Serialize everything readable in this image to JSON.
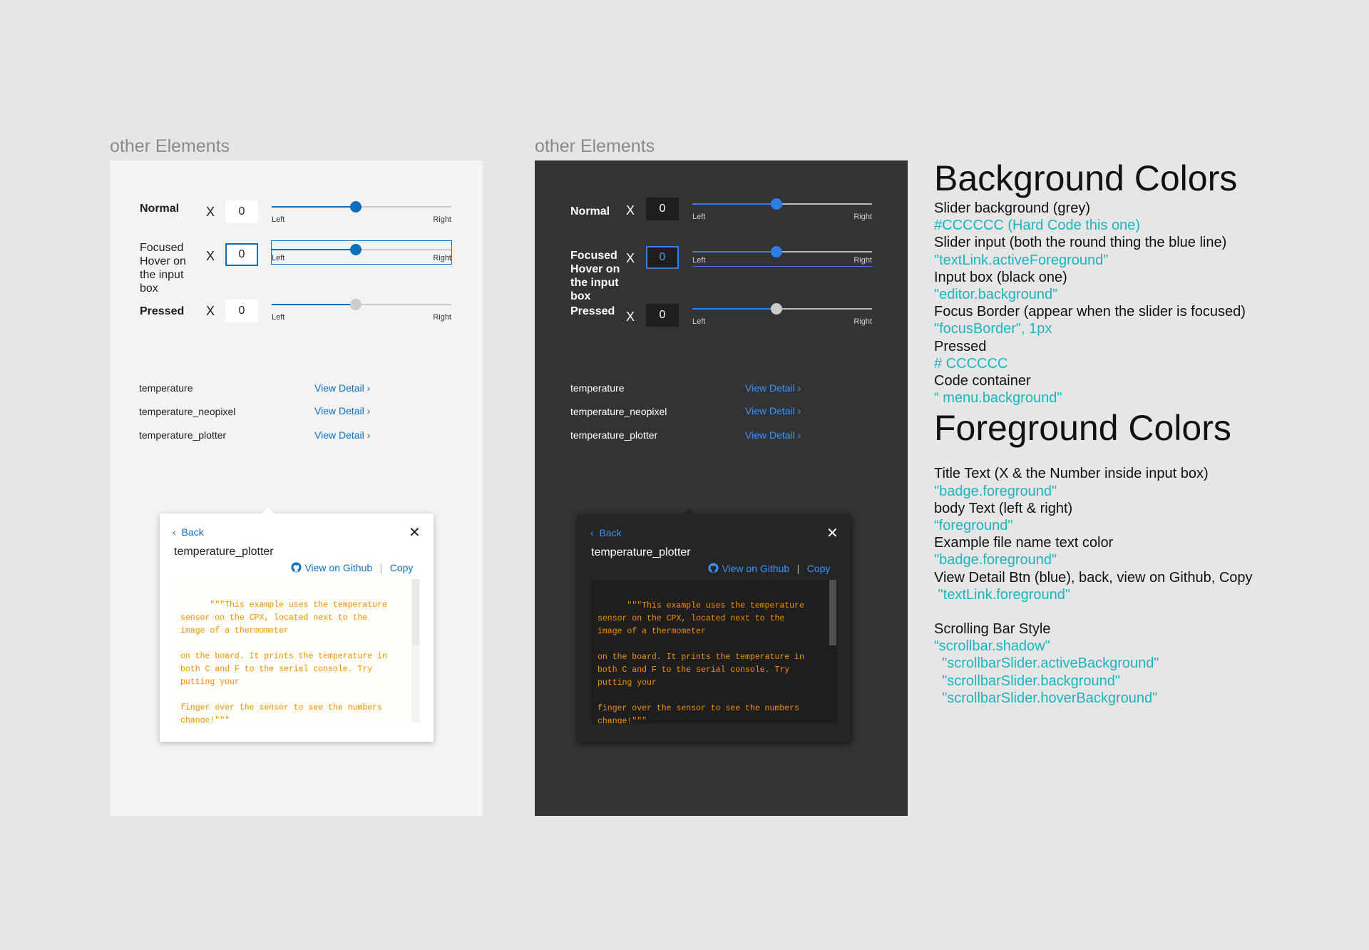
{
  "light": {
    "section_label": "other Elements",
    "rows": [
      {
        "label": "Normal",
        "x": "X",
        "value": "0",
        "left": "Left",
        "right": "Right",
        "progress": 0.47
      },
      {
        "label": "Focused\nHover on\nthe input\nbox",
        "x": "X",
        "value": "0",
        "left": "Left",
        "right": "Right",
        "progress": 0.47
      },
      {
        "label": "Pressed",
        "x": "X",
        "value": "0",
        "left": "Left",
        "right": "Right",
        "progress": 0.47
      }
    ],
    "examples": [
      {
        "name": "temperature",
        "link": "View Detail ›"
      },
      {
        "name": "temperature_neopixel",
        "link": "View Detail ›"
      },
      {
        "name": "temperature_plotter",
        "link": "View Detail ›"
      }
    ],
    "popup": {
      "back": "Back",
      "close": "✕",
      "title": "temperature_plotter",
      "github": "View on Github",
      "separator": "|",
      "copy": "Copy",
      "code": "\"\"\"This example uses the temperature\nsensor on the CPX, located next to the\nimage of a thermometer\n\non the board. It prints the temperature in\nboth C and F to the serial console. Try\nputting your\n\nfinger over the sensor to see the numbers\nchange!\"\"\""
    }
  },
  "dark": {
    "section_label": "other Elements",
    "rows": [
      {
        "label": "Normal",
        "x": "X",
        "value": "0",
        "left": "Left",
        "right": "Right",
        "progress": 0.47
      },
      {
        "label": "Focused\nHover on\nthe input\nbox",
        "x": "X",
        "value": "0",
        "left": "Left",
        "right": "Right",
        "progress": 0.47
      },
      {
        "label": "Pressed",
        "x": "X",
        "value": "0",
        "left": "Left",
        "right": "Right",
        "progress": 0.47
      }
    ],
    "examples": [
      {
        "name": "temperature",
        "link": "View Detail ›"
      },
      {
        "name": "temperature_neopixel",
        "link": "View Detail ›"
      },
      {
        "name": "temperature_plotter",
        "link": "View Detail ›"
      }
    ],
    "popup": {
      "back": "Back",
      "close": "✕",
      "title": "temperature_plotter",
      "github": "View on Github",
      "separator": "|",
      "copy": "Copy",
      "code": "\"\"\"This example uses the temperature\nsensor on the CPX, located next to the\nimage of a thermometer\n\non the board. It prints the temperature in\nboth C and F to the serial console. Try\nputting your\n\nfinger over the sensor to see the numbers\nchange!\"\"\""
    }
  },
  "notes": {
    "bg_heading": "Background Colors",
    "bg": [
      {
        "text": "Slider background (grey)",
        "kind": "dark"
      },
      {
        "text": "#CCCCCC (Hard Code this one)",
        "kind": "teal"
      },
      {
        "text": "Slider input (both the round thing the blue line)",
        "kind": "dark"
      },
      {
        "text": "\"textLink.activeForeground\"",
        "kind": "teal"
      },
      {
        "text": "Input box (black one)",
        "kind": "dark"
      },
      {
        "text": "\"editor.background\"",
        "kind": "teal"
      },
      {
        "text": "Focus Border (appear when the slider is focused)",
        "kind": "dark"
      },
      {
        "text": "\"focusBorder\", 1px",
        "kind": "teal"
      },
      {
        "text": "Pressed",
        "kind": "dark"
      },
      {
        "text": "# CCCCCC",
        "kind": "teal"
      },
      {
        "text": "Code container",
        "kind": "dark"
      },
      {
        "text": "“ menu.background\"",
        "kind": "teal"
      }
    ],
    "fg_heading": "Foreground Colors",
    "fg": [
      {
        "text": "Title Text (X & the Number inside input box)",
        "kind": "dark"
      },
      {
        "text": "\"badge.foreground\"",
        "kind": "teal"
      },
      {
        "text": "body Text (left & right)",
        "kind": "dark"
      },
      {
        "text": "“foreground\"",
        "kind": "teal"
      },
      {
        "text": "Example file name text color",
        "kind": "dark"
      },
      {
        "text": "\"badge.foreground\"",
        "kind": "teal"
      },
      {
        "text": "View Detail Btn (blue), back, view on Github, Copy",
        "kind": "dark"
      },
      {
        "text": " \"textLink.foreground\"",
        "kind": "teal"
      },
      {
        "text": "",
        "kind": "dark"
      },
      {
        "text": "Scrolling Bar Style",
        "kind": "dark"
      },
      {
        "text": "“scrollbar.shadow\"",
        "kind": "teal"
      },
      {
        "text": "  \"scrollbarSlider.activeBackground\"",
        "kind": "teal"
      },
      {
        "text": "  \"scrollbarSlider.background\"",
        "kind": "teal"
      },
      {
        "text": "  \"scrollbarSlider.hoverBackground\"",
        "kind": "teal"
      }
    ]
  },
  "colors": {
    "page_bg": "#e6e6e6",
    "light_panel": "#f3f3f3",
    "dark_panel": "#333333",
    "accent_light": "#0f6fbf",
    "accent_dark": "#2f7ee6",
    "slider_grey": "#cccccc",
    "code_text": "#f29100",
    "teal_note": "#1ab5bd"
  },
  "icons": [
    "chevron-left-icon",
    "close-icon",
    "github-icon",
    "chevron-right-icon"
  ]
}
